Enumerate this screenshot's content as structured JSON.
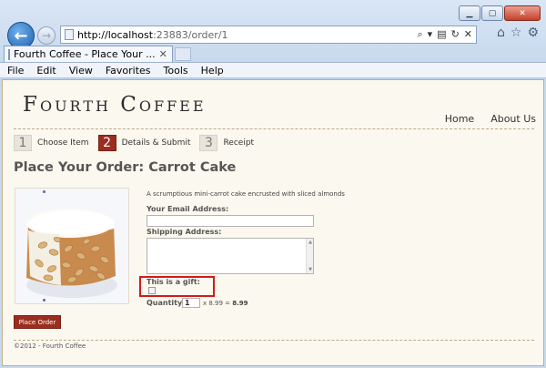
{
  "browser": {
    "url_host": "http://localhost",
    "url_rest": ":23883/order/1",
    "tab_title": "Fourth Coffee - Place Your ...",
    "menu": [
      "File",
      "Edit",
      "View",
      "Favorites",
      "Tools",
      "Help"
    ]
  },
  "site": {
    "logo": "Fourth Coffee",
    "nav": [
      "Home",
      "About Us"
    ]
  },
  "steps": [
    {
      "number": "1",
      "label": "Choose Item",
      "active": false
    },
    {
      "number": "2",
      "label": "Details & Submit",
      "active": true
    },
    {
      "number": "3",
      "label": "Receipt",
      "active": false
    }
  ],
  "order": {
    "title": "Place Your Order: Carrot Cake",
    "description": "A scrumptious mini-carrot cake encrusted with sliced almonds",
    "email_label": "Your Email Address:",
    "email_value": "",
    "shipping_label": "Shipping Address:",
    "shipping_value": "",
    "gift_label": "This is a gift:",
    "gift_checked": false,
    "quantity_label": "Quantity:",
    "quantity_value": "1",
    "price_calc": "x 8.99 =",
    "total": "8.99",
    "submit_label": "Place Order"
  },
  "footer": {
    "text": "©2012 - Fourth Coffee"
  },
  "colors": {
    "accent": "#9b2d1e",
    "page_bg": "#fbf8ef",
    "highlight_box": "#d41a1a"
  },
  "icons": [
    "back-arrow-icon",
    "forward-arrow-icon",
    "page-icon",
    "search-icon",
    "refresh-icon",
    "stop-icon",
    "home-icon",
    "favorites-star-icon",
    "settings-gear-icon",
    "close-icon"
  ]
}
